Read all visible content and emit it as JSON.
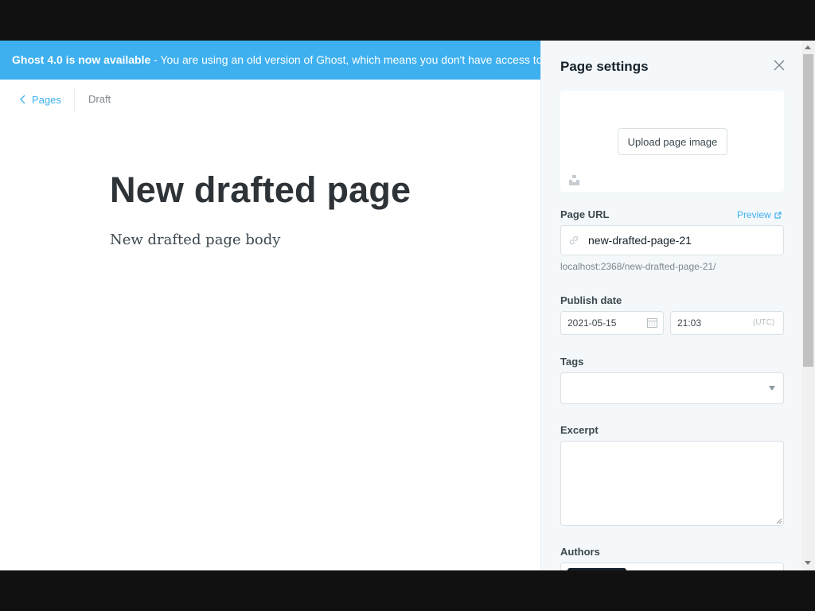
{
  "banner": {
    "title": "Ghost 4.0 is now available",
    "message": " - You are using an old version of Ghost, which means you don't have access to the latest features."
  },
  "header": {
    "back_label": "Pages",
    "status": "Draft"
  },
  "editor": {
    "title": "New drafted page",
    "body": "New drafted page body"
  },
  "settings": {
    "title": "Page settings",
    "upload_label": "Upload page image",
    "url_label": "Page URL",
    "preview_label": "Preview",
    "url_value": "new-drafted-page-21",
    "url_hint": "localhost:2368/new-drafted-page-21/",
    "publish_label": "Publish date",
    "date_value": "2021-05-15",
    "time_value": "21:03",
    "timezone": "(UTC)",
    "tags_label": "Tags",
    "excerpt_label": "Excerpt",
    "authors_label": "Authors"
  },
  "colors": {
    "accent": "#3eb0ef",
    "title": "#2e3338",
    "panel_bg": "#f4f8fb"
  },
  "icons": [
    "chevron-left-icon",
    "close-icon",
    "unsplash-icon",
    "external-link-icon",
    "link-icon",
    "calendar-icon",
    "caret-down-icon"
  ]
}
